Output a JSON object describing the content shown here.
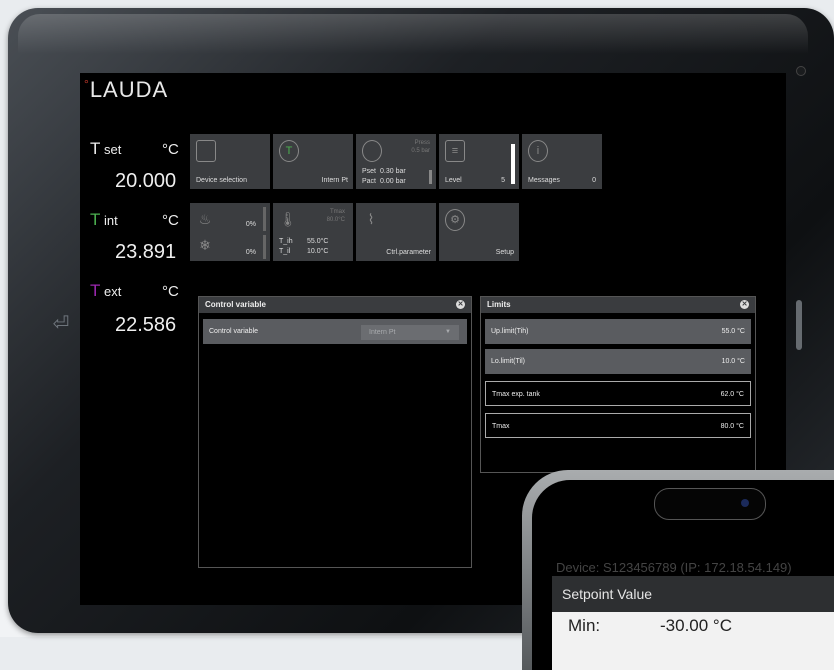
{
  "brand": {
    "logo_text": "LAUDA",
    "logo_mark": "°"
  },
  "temps": {
    "set": {
      "symbol": "T",
      "sub": "set",
      "unit": "°C",
      "value": "20.000"
    },
    "int": {
      "symbol": "T",
      "sub": "int",
      "unit": "°C",
      "value": "23.891"
    },
    "ext": {
      "symbol": "T",
      "sub": "ext",
      "unit": "°C",
      "value": "22.586"
    }
  },
  "tiles": {
    "device_selection": {
      "label": "Device selection"
    },
    "intern_pt": {
      "label": "Intern Pt"
    },
    "pressure": {
      "title": "Press",
      "subtitle": "0.5 bar",
      "pset_label": "Pset",
      "pset_value": "0.30 bar",
      "pact_label": "Pact",
      "pact_value": "0.00 bar"
    },
    "level": {
      "label": "Level",
      "value": "5"
    },
    "messages": {
      "label": "Messages",
      "value": "0"
    },
    "heating": {
      "value": "0%"
    },
    "cooling": {
      "value": "0%"
    },
    "limits_mini": {
      "tmax_label": "Tmax",
      "tmax_value": "80.0°C",
      "tih_label": "T_ih",
      "tih_value": "55.0°C",
      "til_label": "T_il",
      "til_value": "10.0°C"
    },
    "ctrl_parameter": {
      "label": "Ctrl.parameter"
    },
    "setup": {
      "label": "Setup"
    }
  },
  "control_panel": {
    "title": "Control variable",
    "row_label": "Control variable",
    "select_value": "Intern Pt"
  },
  "limits_panel": {
    "title": "Limits",
    "rows": [
      {
        "label": "Up.limit(Tih)",
        "value": "55.0 °C"
      },
      {
        "label": "Lo.limit(Til)",
        "value": "10.0 °C"
      },
      {
        "label": "Tmax exp. tank",
        "value": "62.0 °C"
      },
      {
        "label": "Tmax",
        "value": "80.0 °C"
      }
    ]
  },
  "phone": {
    "device_line": "Device: S123456789 (IP: 172.18.54.149)",
    "dialog_title": "Setpoint Value",
    "min_label": "Min:",
    "min_value": "-30.00 °C"
  },
  "colors": {
    "screen_bg": "#000000",
    "tile_bg": "#3b3d40",
    "int_accent": "#4caf50",
    "ext_accent": "#9c27b0",
    "logo_mark": "#c0392b"
  }
}
